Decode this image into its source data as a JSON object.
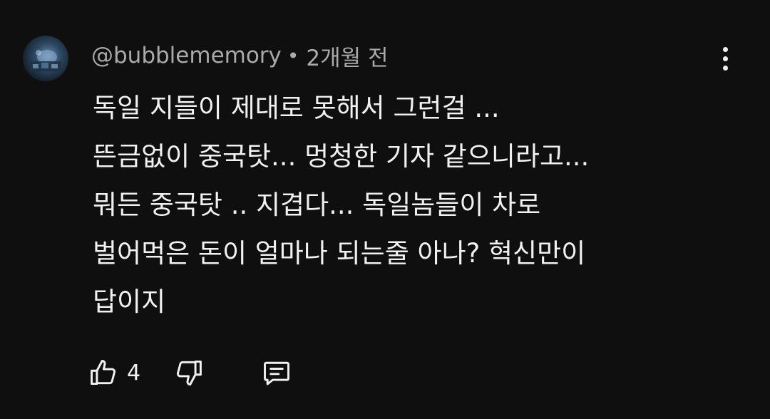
{
  "comment": {
    "author": "@bubblememory",
    "separator": "•",
    "time": "2개월 전",
    "lines": [
      "독일 지들이 제대로 못해서 그런걸 ...",
      "뜬금없이 중국탓... 멍청한 기자 같으니라고...",
      "뭐든 중국탓 .. 지겹다... 독일놈들이 차로",
      "벌어먹은 돈이 얼마나 되는줄 아나? 혁신만이",
      "답이지"
    ],
    "like_count": "4"
  },
  "icons": {
    "menu": "more-vert-icon",
    "like": "thumb-up-icon",
    "dislike": "thumb-down-icon",
    "reply": "comment-icon"
  },
  "colors": {
    "background": "#0f0f0f",
    "primary_text": "#f1f1f1",
    "secondary_text": "#aaaaaa"
  }
}
